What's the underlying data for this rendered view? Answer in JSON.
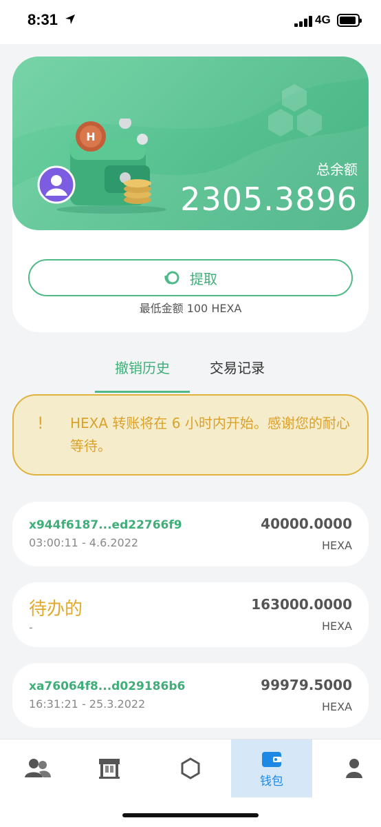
{
  "status_bar": {
    "time": "8:31",
    "network": "4G"
  },
  "wallet": {
    "balance_label": "总余额",
    "balance_value": "2305.3896",
    "withdraw_label": "提取",
    "min_amount": "最低金额 100 HEXA"
  },
  "tabs": [
    {
      "label": "撤销历史",
      "active": true
    },
    {
      "label": "交易记录",
      "active": false
    }
  ],
  "notice": {
    "icon": "!",
    "text": "HEXA 转账将在 6 小时内开始。感谢您的耐心等待。"
  },
  "transactions": [
    {
      "id": "x944f6187...ed22766f9",
      "time": "03:00:11 - 4.6.2022",
      "amount": "40000.0000",
      "unit": "HEXA"
    },
    {
      "status": "待办的",
      "time": "-",
      "amount": "163000.0000",
      "unit": "HEXA"
    },
    {
      "id": "xa76064f8...d029186b6",
      "time": "16:31:21 - 25.3.2022",
      "amount": "99979.5000",
      "unit": "HEXA"
    }
  ],
  "nav": {
    "items": [
      {
        "icon": "team-icon"
      },
      {
        "icon": "shop-icon"
      },
      {
        "icon": "hexagon-icon"
      },
      {
        "icon": "wallet-icon",
        "label": "钱包",
        "active": true
      },
      {
        "icon": "profile-icon"
      }
    ]
  },
  "colors": {
    "accent": "#4fb987",
    "warning": "#e2a92e",
    "nav_active": "#1e88e5"
  }
}
